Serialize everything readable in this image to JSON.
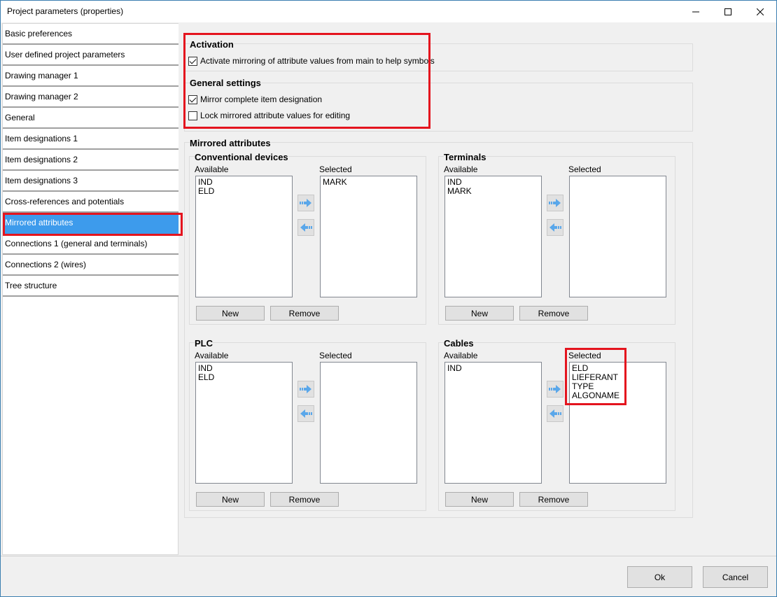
{
  "window": {
    "title": "Project parameters (properties)"
  },
  "nav": {
    "items": [
      {
        "label": "Basic preferences"
      },
      {
        "label": "User defined project parameters"
      },
      {
        "label": "Drawing manager 1"
      },
      {
        "label": "Drawing manager 2"
      },
      {
        "label": "General"
      },
      {
        "label": "Item designations 1"
      },
      {
        "label": "Item designations 2"
      },
      {
        "label": "Item designations 3"
      },
      {
        "label": "Cross-references and potentials"
      },
      {
        "label": "Mirrored attributes"
      },
      {
        "label": "Connections 1 (general and terminals)"
      },
      {
        "label": "Connections 2 (wires)"
      },
      {
        "label": "Tree structure"
      }
    ],
    "selected": "Mirrored attributes"
  },
  "activation": {
    "title": "Activation",
    "mirror_label": "Activate mirroring of attribute values from main to help symbols",
    "mirror_checked": true
  },
  "general_settings": {
    "title": "General settings",
    "complete_label": "Mirror complete item designation",
    "complete_checked": true,
    "lock_label": "Lock mirrored attribute values for editing",
    "lock_checked": false
  },
  "mirrored": {
    "title": "Mirrored attributes",
    "available_label": "Available",
    "selected_label": "Selected",
    "new_label": "New",
    "remove_label": "Remove",
    "conventional": {
      "title": "Conventional devices",
      "available": [
        "IND",
        "ELD"
      ],
      "selected": [
        "MARK"
      ]
    },
    "terminals": {
      "title": "Terminals",
      "available": [
        "IND",
        "MARK"
      ],
      "selected": []
    },
    "plc": {
      "title": "PLC",
      "available": [
        "IND",
        "ELD"
      ],
      "selected": []
    },
    "cables": {
      "title": "Cables",
      "available": [
        "IND"
      ],
      "selected": [
        "ELD",
        "LIEFERANT",
        "TYPE",
        "ALGONAME"
      ]
    }
  },
  "footer": {
    "ok_label": "Ok",
    "cancel_label": "Cancel"
  },
  "colors": {
    "selection": "#3d9bec",
    "highlight": "#e4141e",
    "arrow": "#5aa7ea"
  },
  "icons": {
    "minimize": "minimize-icon",
    "maximize": "maximize-icon",
    "close": "close-icon",
    "arrow_right": "arrow-right-icon",
    "arrow_left": "arrow-left-icon"
  }
}
